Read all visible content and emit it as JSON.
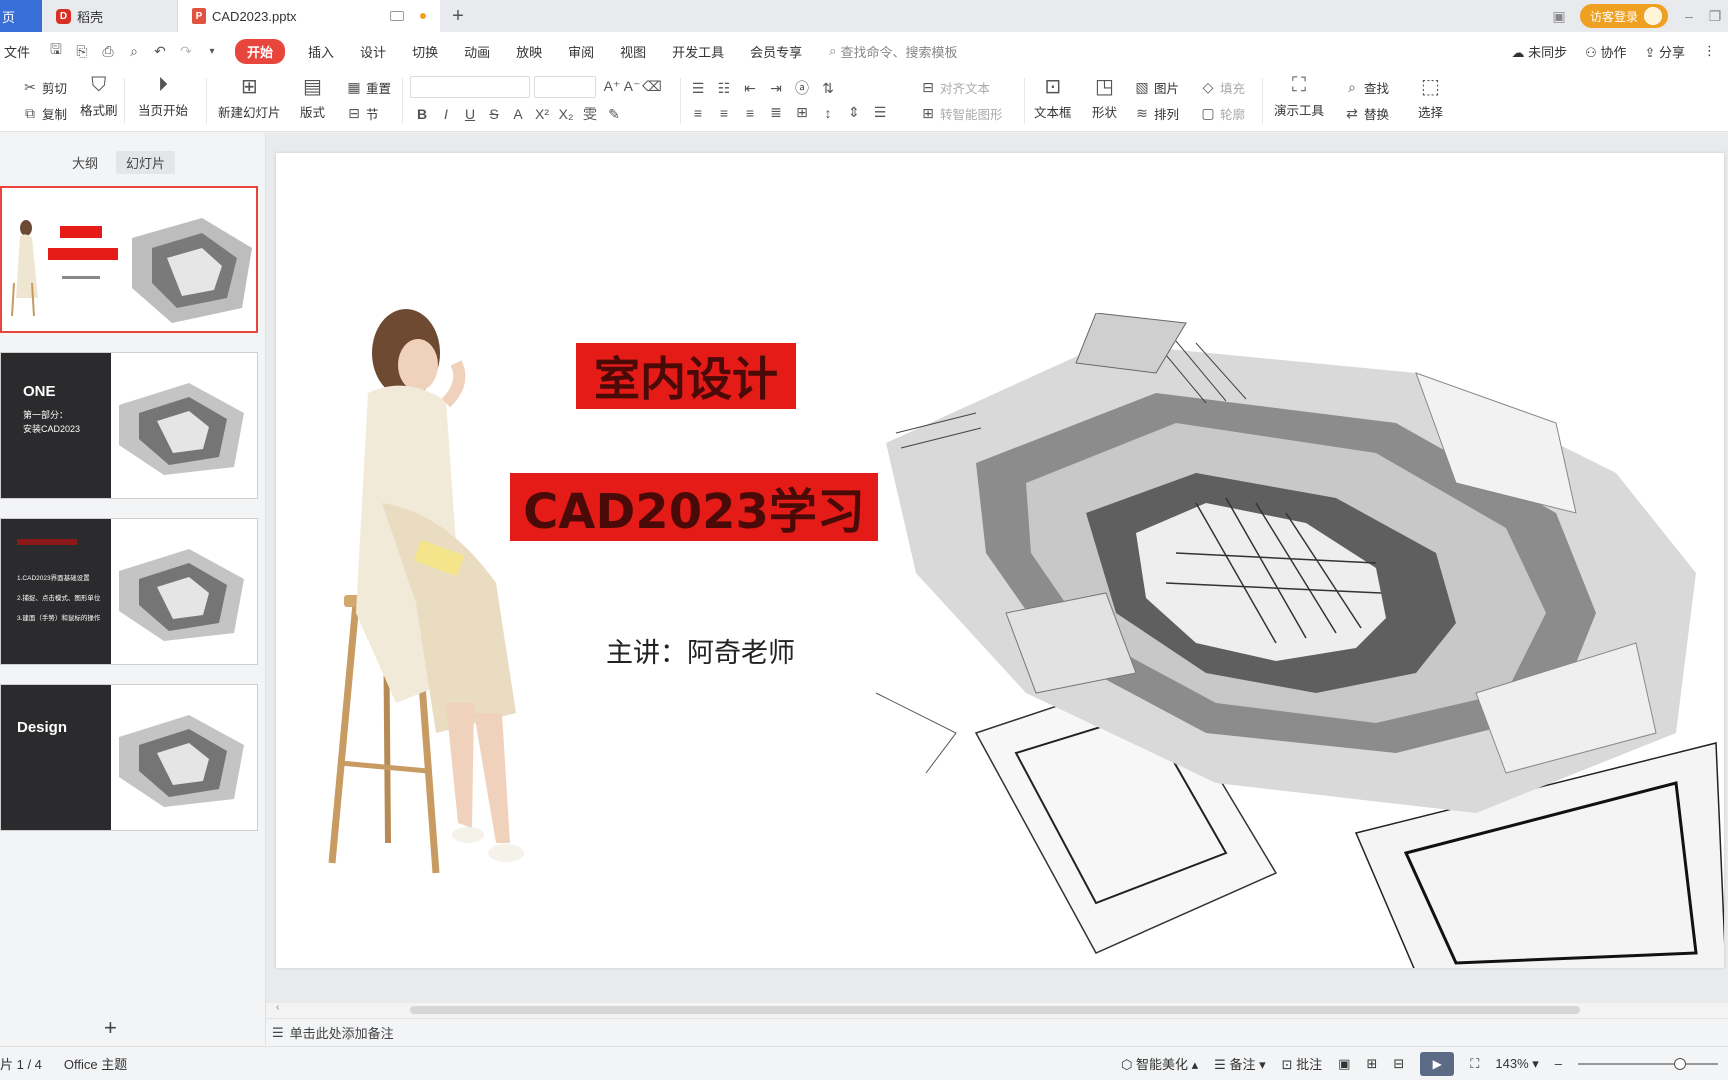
{
  "tabs": {
    "home": "页",
    "app": "稻壳",
    "doc": "CAD2023.pptx"
  },
  "header_right": {
    "login": "访客登录"
  },
  "menu": {
    "file": "文件",
    "items": [
      "开始",
      "插入",
      "设计",
      "切换",
      "动画",
      "放映",
      "审阅",
      "视图",
      "开发工具",
      "会员专享"
    ],
    "search": "查找命令、搜索模板",
    "sync": "未同步",
    "collab": "协作",
    "share": "分享"
  },
  "ribbon": {
    "cut": "剪切",
    "copy": "复制",
    "format_painter": "格式刷",
    "from_current": "当页开始",
    "new_slide": "新建幻灯片",
    "layout": "版式",
    "reset": "重置",
    "section": "节",
    "align_text": "对齐文本",
    "to_smartart": "转智能图形",
    "textbox": "文本框",
    "shape": "形状",
    "picture": "图片",
    "fill": "填充",
    "arrange": "排列",
    "outline": "轮廓",
    "present_tools": "演示工具",
    "find": "查找",
    "replace": "替换",
    "select": "选择"
  },
  "panel": {
    "tab_outline": "大纲",
    "tab_slides": "幻灯片",
    "slide2_big": "ONE",
    "slide2_small_1": "第一部分：",
    "slide2_small_2": "安装CAD2023",
    "slide3_lines": [
      "1.CAD2023界面基础设置",
      "2.捕捉、点击模式、图形单位",
      "3.建面（手势）和鼠标的操作"
    ],
    "slide4_big": "Design"
  },
  "slide": {
    "title1": "室内设计",
    "title2": "CAD2023学习",
    "presenter": "主讲：阿奇老师"
  },
  "notes": "单击此处添加备注",
  "status": {
    "slide_index": "片 1 / 4",
    "theme": "Office 主题",
    "beautify": "智能美化",
    "notes": "备注",
    "comments": "批注",
    "zoom": "143%"
  },
  "colors": {
    "accent": "#e8453c",
    "title_red": "#e41b17",
    "home_tab": "#3b6fd8",
    "login": "#f0a020"
  }
}
